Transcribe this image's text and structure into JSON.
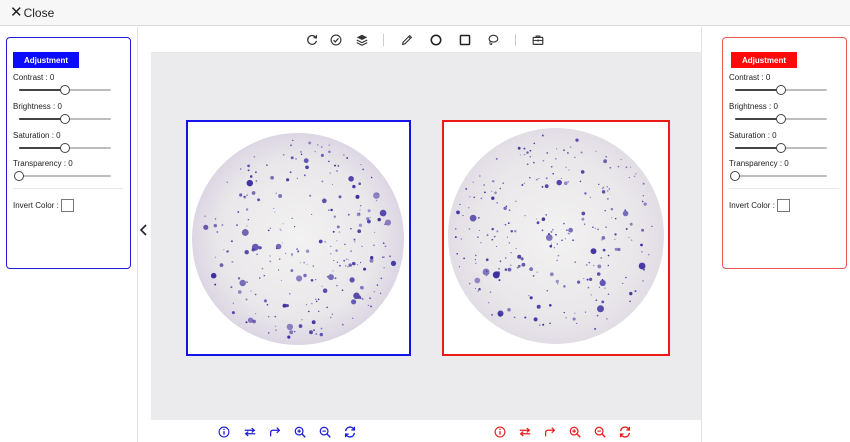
{
  "topbar": {
    "close_label": "Close"
  },
  "colors": {
    "left_accent": "#0b0bff",
    "right_accent": "#ff0a0a",
    "canvas_bg": "#ebebee",
    "colony_purple": "#3a2da0"
  },
  "left_panel": {
    "button_label": "Adjustment",
    "contrast": {
      "label": "Contrast : 0",
      "value": 0,
      "min": -100,
      "max": 100
    },
    "brightness": {
      "label": "Brightness : 0",
      "value": 0,
      "min": -100,
      "max": 100
    },
    "saturation": {
      "label": "Saturation : 0",
      "value": 0,
      "min": -100,
      "max": 100
    },
    "transparency": {
      "label": "Transparency : 0",
      "value": 0,
      "min": 0,
      "max": 100
    },
    "invert_label": "Invert Color :",
    "invert_checked": false
  },
  "right_panel": {
    "button_label": "Adjustment",
    "contrast": {
      "label": "Contrast : 0",
      "value": 0,
      "min": -100,
      "max": 100
    },
    "brightness": {
      "label": "Brightness : 0",
      "value": 0,
      "min": -100,
      "max": 100
    },
    "saturation": {
      "label": "Saturation : 0",
      "value": 0,
      "min": -100,
      "max": 100
    },
    "transparency": {
      "label": "Transparency : 0",
      "value": 0,
      "min": 0,
      "max": 100
    },
    "invert_label": "Invert Color :",
    "invert_checked": false
  },
  "toolbar": {
    "icons": [
      "refresh-icon",
      "check-circle-icon",
      "layers-icon",
      "pencil-icon",
      "circle-icon",
      "square-icon",
      "lasso-icon",
      "toolbox-icon"
    ]
  },
  "bottom_toolbar": {
    "icons": [
      "info-icon",
      "swap-icon",
      "redo-icon",
      "zoom-in-icon",
      "zoom-out-icon",
      "sync-icon"
    ]
  }
}
